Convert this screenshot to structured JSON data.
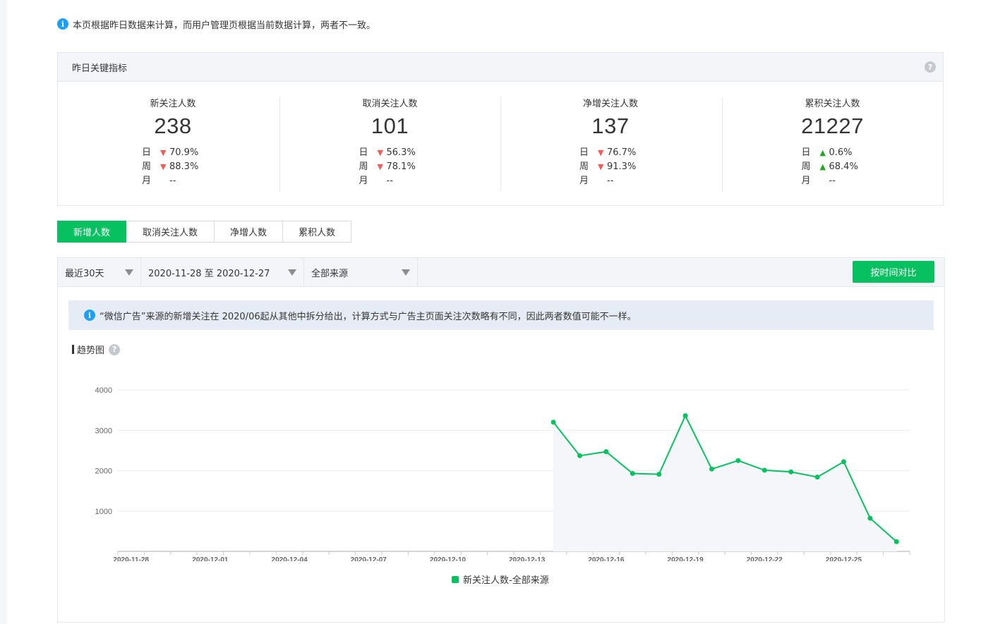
{
  "notice": {
    "text": "本页根据昨日数据来计算，而用户管理页根据当前数据计算，两者不一致。"
  },
  "kpi": {
    "title": "昨日关键指标",
    "cards": [
      {
        "label": "新关注人数",
        "value": "238",
        "day": {
          "key": "日",
          "dir": "down",
          "val": "70.9%"
        },
        "week": {
          "key": "周",
          "dir": "down",
          "val": "88.3%"
        },
        "month": {
          "key": "月",
          "val": "--"
        }
      },
      {
        "label": "取消关注人数",
        "value": "101",
        "day": {
          "key": "日",
          "dir": "down",
          "val": "56.3%"
        },
        "week": {
          "key": "周",
          "dir": "down",
          "val": "78.1%"
        },
        "month": {
          "key": "月",
          "val": "--"
        }
      },
      {
        "label": "净增关注人数",
        "value": "137",
        "day": {
          "key": "日",
          "dir": "down",
          "val": "76.7%"
        },
        "week": {
          "key": "周",
          "dir": "down",
          "val": "91.3%"
        },
        "month": {
          "key": "月",
          "val": "--"
        }
      },
      {
        "label": "累积关注人数",
        "value": "21227",
        "day": {
          "key": "日",
          "dir": "up",
          "val": "0.6%"
        },
        "week": {
          "key": "周",
          "dir": "up",
          "val": "68.4%"
        },
        "month": {
          "key": "月",
          "val": "--"
        }
      }
    ]
  },
  "tabs": [
    "新增人数",
    "取消关注人数",
    "净增人数",
    "累积人数"
  ],
  "filters": {
    "range": "最近30天",
    "dates": "2020-11-28 至 2020-12-27",
    "source": "全部来源",
    "compare_label": "按时间对比"
  },
  "banner": {
    "text": "“微信广告”来源的新增关注在 2020/06起从其他中拆分给出，计算方式与广告主页面关注次数略有不同，因此两者数值可能不一样。"
  },
  "trend": {
    "title": "趋势图"
  },
  "colors": {
    "accent": "#07c160",
    "down": "#f45b5b",
    "up": "#1aad19",
    "info": "#1e9fff"
  },
  "chart_data": {
    "type": "area",
    "x_ticks": [
      "2020-11-28",
      "2020-12-01",
      "2020-12-04",
      "2020-12-07",
      "2020-12-10",
      "2020-12-13",
      "2020-12-16",
      "2020-12-19",
      "2020-12-22",
      "2020-12-25"
    ],
    "y_ticks": [
      1000,
      2000,
      3000,
      4000
    ],
    "ylim": [
      0,
      4000
    ],
    "grid": true,
    "legend_position": "bottom",
    "series": [
      {
        "name": "新关注人数-全部来源",
        "x": [
          "2020-12-14",
          "2020-12-15",
          "2020-12-16",
          "2020-12-17",
          "2020-12-18",
          "2020-12-19",
          "2020-12-20",
          "2020-12-21",
          "2020-12-22",
          "2020-12-23",
          "2020-12-24",
          "2020-12-25",
          "2020-12-26",
          "2020-12-27"
        ],
        "values": [
          3200,
          2370,
          2470,
          1930,
          1910,
          3360,
          2040,
          2250,
          2010,
          1970,
          1840,
          2220,
          820,
          240
        ]
      }
    ]
  }
}
